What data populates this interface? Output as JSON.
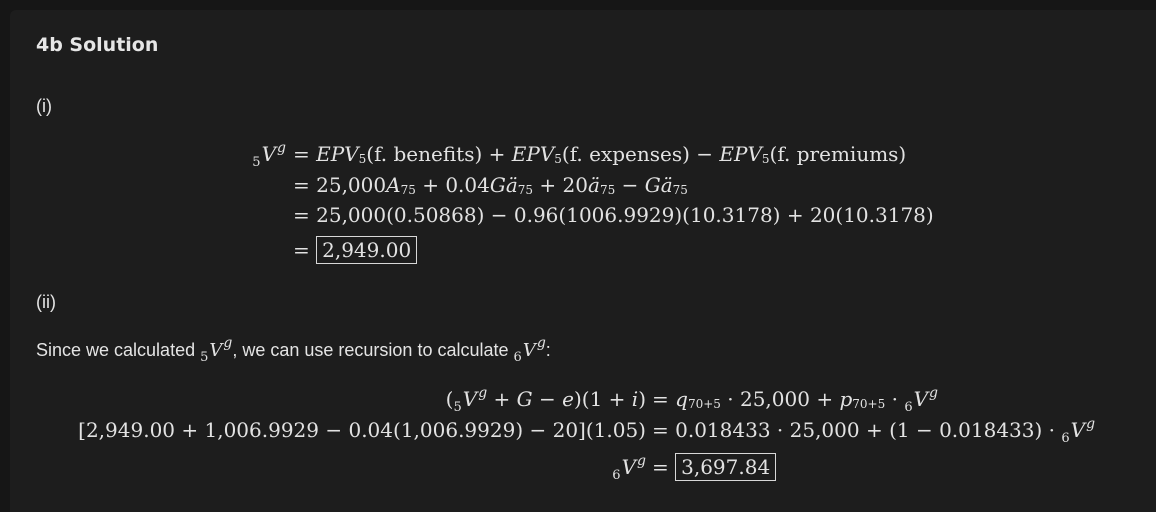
{
  "heading": "4b Solution",
  "part_i": {
    "label": "(i)",
    "eq_lines": [
      "= 25,000(0.50868) − 0.96(1006.9929)(10.3178) + 20(10.3178)"
    ],
    "result": "2,949.00",
    "sym": {
      "epv": "EPV",
      "benefits": "(f. benefits)",
      "expenses": "(f. expenses)",
      "premiums": "(f. premiums)",
      "five": "5",
      "seventyfive": "75",
      "a": "A",
      "addot": "ä",
      "coef1": "25,000",
      "coef2": "0.04",
      "coef3": "20",
      "g": "G"
    }
  },
  "part_ii": {
    "label": "(ii)",
    "intro_a": "Since we calculated",
    "intro_b": ", we can use recursion to calculate",
    "intro_c": ":",
    "line2_lhs": "[2,949.00 + 1,006.9929 − 0.04(1,006.9929) − 20](1.05)",
    "line2_rhs": "= 0.018433 · 25,000 + (1 − 0.018433) ·",
    "result": "3,697.84",
    "sym": {
      "v": "V",
      "g_sup": "g",
      "five": "5",
      "six": "6",
      "q": "q",
      "p": "p",
      "age": "70+5",
      "amount": "25,000"
    }
  }
}
